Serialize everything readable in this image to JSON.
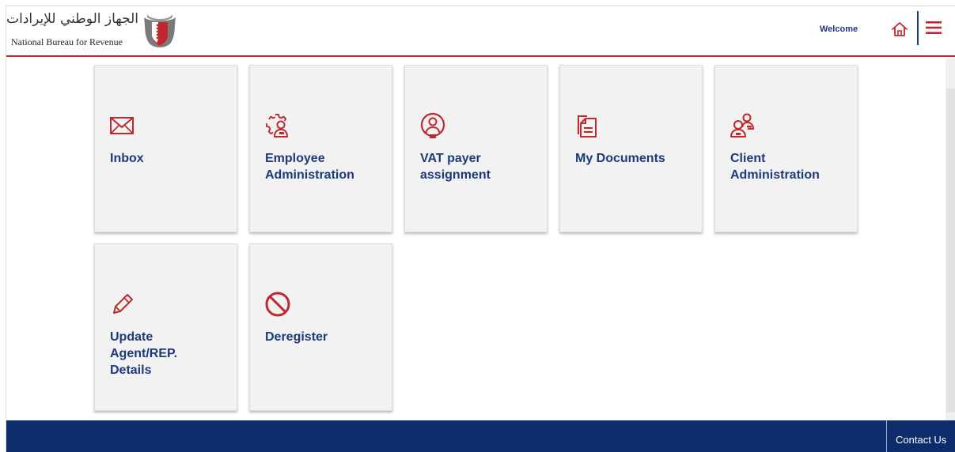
{
  "header": {
    "logo_arabic": "الجهاز الوطني للإيرادات",
    "logo_english": "National Bureau for Revenue",
    "welcome": "Welcome",
    "home_icon": "home-icon",
    "menu_icon": "hamburger-menu-icon"
  },
  "tiles": [
    {
      "label": "Inbox",
      "icon": "envelope-icon"
    },
    {
      "label": "Employee\nAdministration",
      "icon": "gear-user-icon"
    },
    {
      "label": "VAT payer\nassignment",
      "icon": "assigned-user-icon"
    },
    {
      "label": "My Documents",
      "icon": "documents-icon"
    },
    {
      "label": "Client\nAdministration",
      "icon": "users-icon"
    },
    {
      "label": "Update\nAgent/REP.\nDetails",
      "icon": "pencil-icon"
    },
    {
      "label": "Deregister",
      "icon": "prohibited-icon"
    }
  ],
  "footer": {
    "contact": "Contact Us"
  },
  "colors": {
    "accent_red": "#c0282d",
    "brand_blue": "#1d3a7a",
    "footer_blue": "#0d2c6b",
    "tile_bg": "#f2f2f2"
  }
}
